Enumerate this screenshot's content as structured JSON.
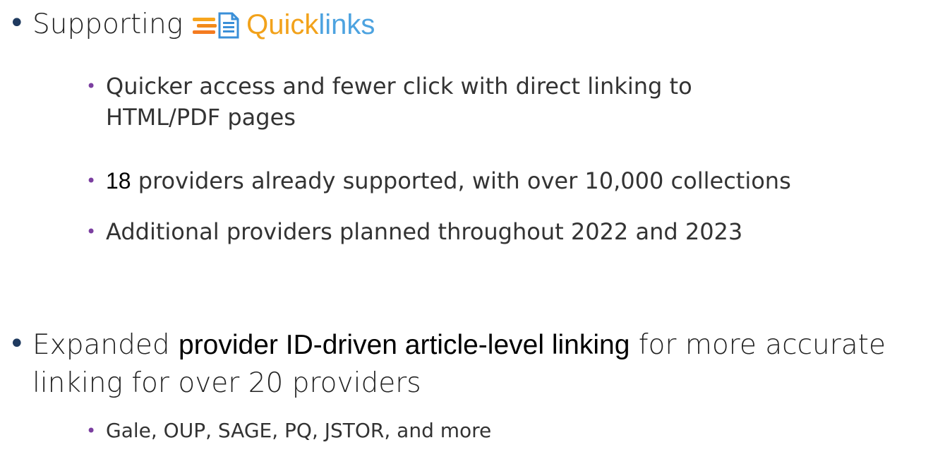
{
  "bullets": {
    "b1": {
      "text": "Supporting",
      "logo_quick": "Quick",
      "logo_links": "links",
      "colors": {
        "quick": "#f2a21b",
        "links": "#4da3e0"
      },
      "icon": "quicklinks-logo-icon",
      "sub": [
        {
          "text": "Quicker access and fewer click with direct linking to HTML/PDF pages"
        },
        {
          "highlight": "18",
          "text": " providers already supported, with over 10,000 collections"
        },
        {
          "text": "Additional providers planned throughout 2022 and 2023"
        }
      ]
    },
    "b2": {
      "text_before": "Expanded ",
      "highlight": "provider ID-driven article-level linking",
      "text_after": " for more accurate linking for over 20 providers",
      "sub": [
        {
          "text": "Gale, OUP, SAGE, PQ, JSTOR, and more"
        }
      ]
    }
  }
}
